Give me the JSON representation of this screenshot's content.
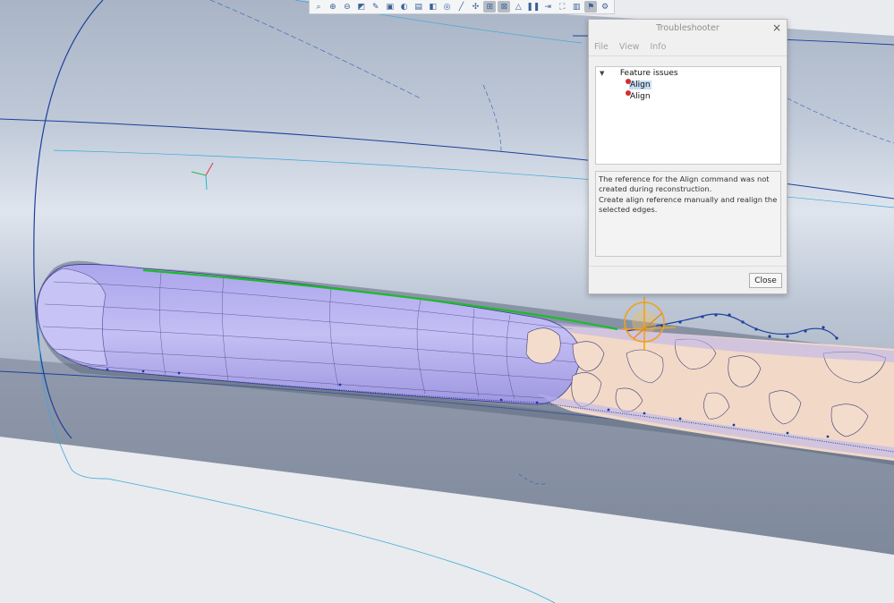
{
  "toolbar": {
    "buttons": [
      {
        "name": "zoom-fit-icon",
        "glyph": "⌕"
      },
      {
        "name": "zoom-in-icon",
        "glyph": "⊕"
      },
      {
        "name": "zoom-out-icon",
        "glyph": "⊖"
      },
      {
        "name": "view-plane-icon",
        "glyph": "◩"
      },
      {
        "name": "measure-icon",
        "glyph": "✎"
      },
      {
        "name": "view-cube-icon",
        "glyph": "▣"
      },
      {
        "name": "render-mode-icon",
        "glyph": "◐"
      },
      {
        "name": "section-icon",
        "glyph": "▤"
      },
      {
        "name": "display-style-icon",
        "glyph": "◧"
      },
      {
        "name": "hide-icon",
        "glyph": "◎"
      },
      {
        "name": "sketch-line-icon",
        "glyph": "╱"
      },
      {
        "name": "snap-icon",
        "glyph": "✣"
      },
      {
        "name": "align-mode-icon",
        "glyph": "⊞",
        "active": true
      },
      {
        "name": "transform-icon",
        "glyph": "⊠",
        "active": true
      },
      {
        "name": "mesh-icon",
        "glyph": "△"
      },
      {
        "name": "pause-icon",
        "glyph": "❚❚"
      },
      {
        "name": "step-icon",
        "glyph": "⇥"
      },
      {
        "name": "fit-selection-icon",
        "glyph": "⛶"
      },
      {
        "name": "scene-icon",
        "glyph": "▥"
      },
      {
        "name": "troubleshooter-icon",
        "glyph": "⚑",
        "active": true
      },
      {
        "name": "settings-icon",
        "glyph": "⚙"
      }
    ]
  },
  "dialog": {
    "title": "Troubleshooter",
    "close_glyph": "×",
    "menu": [
      "File",
      "View",
      "Info"
    ],
    "tree": {
      "root_label": "Feature issues",
      "items": [
        {
          "label": "Align",
          "selected": true,
          "status_color": "#d42d2d"
        },
        {
          "label": "Align",
          "selected": false,
          "status_color": "#d42d2d"
        }
      ]
    },
    "description": [
      "The reference for the Align command was not created during reconstruction.",
      "Create align reference manually and realign the selected edges."
    ],
    "close_button": "Close"
  },
  "colors": {
    "surface": "#b7c1d0",
    "cavity": "#b7b1ef",
    "lattice": "#f2d9c7",
    "edge": "#1c3f9b",
    "highlight": "#1dbb2a",
    "manipulator": "#f0a21c"
  }
}
